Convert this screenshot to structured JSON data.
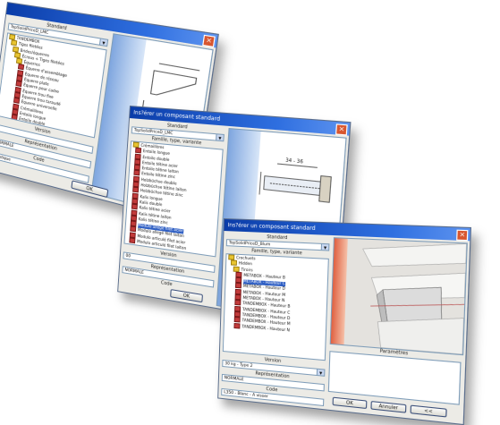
{
  "w1": {
    "title": "Standard",
    "combo": "TopSolidPriceD_LMC",
    "tree": [
      "TANDEMBOX",
      "Tiges filetées",
      "Brides/équerres",
      "Écrous + Tiges filetées",
      "Équerres",
      "Équerre d'assemblage",
      "Équerre de réseau",
      "Équerre plate",
      "Équerre pour cadre",
      "Équerre trou fixe",
      "Équerre trou taraudé",
      "Équerre universelle",
      "Crémaillères",
      "Entoile longue",
      "Entoile double"
    ],
    "version_label": "Version",
    "repr_label": "Représentation",
    "repr_value": "NORMALE",
    "code_label": "Code",
    "code_value": "Plastique",
    "ok": "OK"
  },
  "w2": {
    "title": "Ins?érer un composant standard",
    "standard_label": "Standard",
    "combo": "TopSolidPriceD_LMC",
    "family_label": "Famille, type, variante",
    "tree": [
      "Crémaillères",
      "Entoile longue",
      "Entoile double",
      "Entoile tétine acier",
      "Entoile tétine laiton",
      "Entoile tétine zinc",
      "Holzbüchse double",
      "Holzbüchse tétine laiton",
      "Holzbüchse tétine zinc",
      "Kalis longue",
      "Kalis double",
      "Kalis tétine acier",
      "Kalis tétine laiton",
      "Kalis tétine zinc",
      "Modulo allegé filet acier",
      "Modulo allegé filet laiton",
      "Modulo articulé filet acier",
      "Modulo articulé filet laiton"
    ],
    "selected": 14,
    "version_label": "Version",
    "version_value": "00",
    "repr_label": "Représentation",
    "repr_value": "NORMALE",
    "code_label": "Code",
    "ok": "OK",
    "dim": "34 - 36"
  },
  "w3": {
    "title": "Ins?érer un composant standard",
    "standard_label": "Standard",
    "combo": "TopSolidPriceD_Blum",
    "family_label": "Famille, type, variante",
    "tree": [
      "Crochuets",
      "Hidden",
      "Tiroirs",
      "METABOX - Hauteur B",
      "METABOX - Hauteur C",
      "METABOX - Hauteur D",
      "METABOX - Hauteur M",
      "METABOX - Hauteur N",
      "TANDEMBOX - Hauteur B",
      "TANDEMBOX - Hauteur C",
      "TANDEMBOX - Hauteur D",
      "TANDEMBOX - Hauteur M",
      "TANDEMBOX - Hauteur N"
    ],
    "selected": 4,
    "params_label": "Paramètres",
    "version_label": "Version",
    "version_value": "30 kg - Type 2",
    "repr_label": "Représentation",
    "repr_value": "NORMALE",
    "code_label": "Code",
    "code_value": "L350 - Blanc - A visser",
    "ok": "OK",
    "cancel": "Annuler",
    "extra": "<<"
  }
}
